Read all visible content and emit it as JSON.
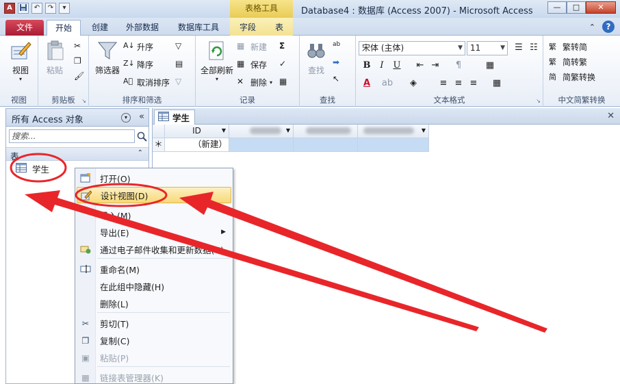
{
  "titlebar": {
    "window_title": "Database4 : 数据库 (Access 2007)  -  Microsoft Access",
    "context_tab_title": "表格工具",
    "qat_app": "A",
    "qat_undo": "↶",
    "qat_redo": "↷",
    "minimize": "—",
    "maximize": "□",
    "close": "✕"
  },
  "tabs": [
    "文件",
    "开始",
    "创建",
    "外部数据",
    "数据库工具",
    "字段",
    "表"
  ],
  "help": "?",
  "ribbon": {
    "view": {
      "label": "视图",
      "group": "视图"
    },
    "clipboard": {
      "paste": "粘贴",
      "group": "剪贴板"
    },
    "sort": {
      "filter": "筛选器",
      "asc": "升序",
      "desc": "降序",
      "clear": "取消排序",
      "group": "排序和筛选"
    },
    "records": {
      "refresh": "全部刷新",
      "new": "新建",
      "save": "保存",
      "delete": "删除",
      "sum": "Σ",
      "group": "记录"
    },
    "find": {
      "find": "查找",
      "group": "查找"
    },
    "text": {
      "font": "宋体 (主体)",
      "size": "11",
      "bold": "B",
      "italic": "I",
      "underline": "U",
      "color_a": "A",
      "group": "文本格式"
    },
    "chinese": {
      "t2s": "繁转简",
      "s2t": "简转繁",
      "convert": "简繁转换",
      "group": "中文简繁转换"
    }
  },
  "navpane": {
    "title": "所有 Access 对象",
    "search_placeholder": "搜索...",
    "section": "表",
    "items": [
      {
        "label": "学生"
      }
    ]
  },
  "document": {
    "tab": "学生",
    "columns": [
      {
        "label": "ID"
      }
    ],
    "new_row_marker": "＊",
    "new_row_label": "（新建）"
  },
  "context_menu": {
    "items": [
      {
        "label": "打开(O)"
      },
      {
        "label": "设计视图(D)"
      },
      {
        "label": "导入(M)"
      },
      {
        "label": "导出(E)"
      },
      {
        "label": "通过电子邮件收集和更新数据(C)"
      },
      {
        "label": "重命名(M)"
      },
      {
        "label": "在此组中隐藏(H)"
      },
      {
        "label": "删除(L)"
      },
      {
        "label": "剪切(T)"
      },
      {
        "label": "复制(C)"
      },
      {
        "label": "粘贴(P)"
      },
      {
        "label": "链接表管理器(K)"
      }
    ]
  },
  "colors": {
    "annotation_red": "#e8262a",
    "file_tab": "#c0283e",
    "highlight": "#f7d978",
    "selected_cell": "#c6dcf4"
  }
}
